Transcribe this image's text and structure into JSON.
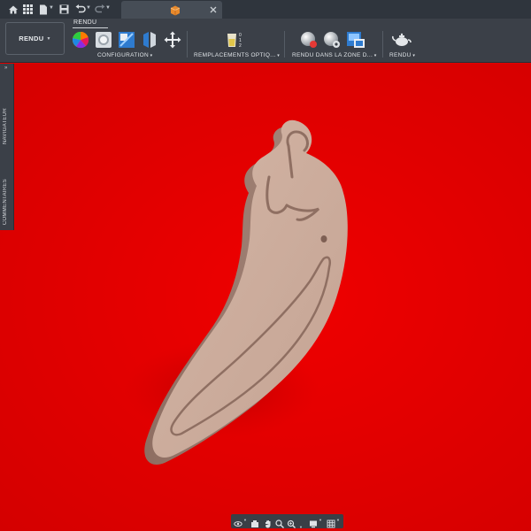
{
  "topbar": {
    "icons": [
      "home-icon",
      "grid-icon",
      "file-icon",
      "save-icon",
      "undo-icon",
      "redo-icon",
      "close-icon"
    ],
    "document_icon": "box-icon"
  },
  "ribbon": {
    "workspace_button": "RENDU",
    "active_tab": "RENDU",
    "groups": [
      {
        "label": "CONFIGURATION",
        "icons": [
          "appearance-icon",
          "scene-settings-icon",
          "texture-map-icon",
          "decal-icon",
          "move-icon"
        ]
      },
      {
        "label": "REMPLACEMENTS OPTIQ...",
        "icons": [
          "physical-material-icon"
        ]
      },
      {
        "label": "RENDU DANS LA ZONE D...",
        "icons": [
          "render-sphere-icon",
          "render-sphere-settings-icon",
          "capture-image-icon"
        ]
      },
      {
        "label": "RENDU",
        "icons": [
          "teapot-render-icon"
        ]
      }
    ]
  },
  "sidepanel": {
    "navigator": "NAVIGATEUR",
    "comments": "COMMENTAIRES"
  },
  "viewport": {
    "background_color": "#e00000",
    "model_color": "#c9a999"
  },
  "navbar": {
    "icons": [
      "orbit-icon",
      "look-at-icon",
      "pan-icon",
      "zoom-icon",
      "fit-icon",
      "display-mode-icon",
      "grid-display-icon"
    ]
  }
}
